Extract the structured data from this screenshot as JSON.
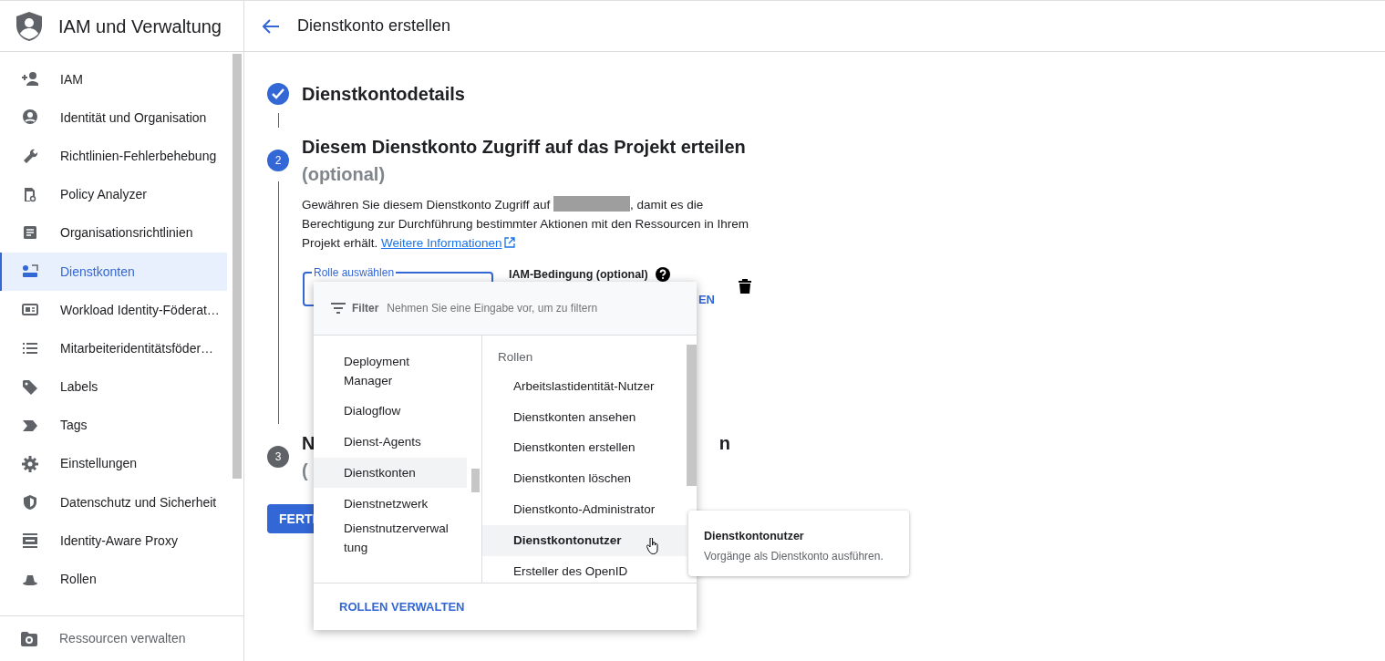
{
  "sidebar": {
    "title": "IAM und Verwaltung",
    "items": [
      {
        "label": "IAM",
        "selected": false
      },
      {
        "label": "Identität und Organisation",
        "selected": false
      },
      {
        "label": "Richtlinien-Fehlerbehebung",
        "selected": false
      },
      {
        "label": "Policy Analyzer",
        "selected": false
      },
      {
        "label": "Organisationsrichtlinien",
        "selected": false
      },
      {
        "label": "Dienstkonten",
        "selected": true
      },
      {
        "label": "Workload Identity-Föderat…",
        "selected": false
      },
      {
        "label": "Mitarbeiteridentitätsföder…",
        "selected": false
      },
      {
        "label": "Labels",
        "selected": false
      },
      {
        "label": "Tags",
        "selected": false
      },
      {
        "label": "Einstellungen",
        "selected": false
      },
      {
        "label": "Datenschutz und Sicherheit",
        "selected": false
      },
      {
        "label": "Identity-Aware Proxy",
        "selected": false
      },
      {
        "label": "Rollen",
        "selected": false
      }
    ],
    "footer": "Ressourcen verwalten"
  },
  "header": {
    "title": "Dienstkonto erstellen"
  },
  "steps": [
    {
      "kind": "done",
      "title": "Dienstkontodetails"
    },
    {
      "kind": "active",
      "number": "2",
      "title": "Diesem Dienstkonto Zugriff auf das Projekt erteilen",
      "subtitle": "(optional)",
      "description_before": "Gewähren Sie diesem Dienstkonto Zugriff auf",
      "description_after": ", damit es die Berechtigung zur Durchführung bestimmter Aktionen mit den Ressourcen in Ihrem Projekt erhält.",
      "link": "Weitere Informationen"
    },
    {
      "kind": "pending",
      "number": "3",
      "title_start": "N",
      "title_end": "n",
      "subtitle": "("
    }
  ],
  "role_field": {
    "label": "Rolle auswählen"
  },
  "condition": {
    "label": "IAM-Bedingung (optional)",
    "button": "EN"
  },
  "done_button": "FERTI",
  "menu": {
    "filter_label": "Filter",
    "filter_placeholder": "Nehmen Sie eine Eingabe vor, um zu filtern",
    "services": [
      {
        "label": "Deployment Manager",
        "selected": false
      },
      {
        "label": "Dialogflow",
        "selected": false
      },
      {
        "label": "Dienst-Agents",
        "selected": false
      },
      {
        "label": "Dienstkonten",
        "selected": true
      },
      {
        "label": "Dienstnetzwerk",
        "selected": false
      },
      {
        "label": "Dienstnutzerverwal tung",
        "selected": false
      }
    ],
    "roles_header": "Rollen",
    "roles": [
      {
        "label": "Arbeitslastidentität-Nutzer",
        "selected": false
      },
      {
        "label": "Dienstkonten ansehen",
        "selected": false
      },
      {
        "label": "Dienstkonten erstellen",
        "selected": false
      },
      {
        "label": "Dienstkonten löschen",
        "selected": false
      },
      {
        "label": "Dienstkonto-Administrator",
        "selected": false
      },
      {
        "label": "Dienstkontonutzer",
        "selected": true
      },
      {
        "label": "Ersteller des OpenID",
        "selected": false
      }
    ],
    "footer_button": "ROLLEN VERWALTEN"
  },
  "tooltip": {
    "title": "Dienstkontonutzer",
    "text": "Vorgänge als Dienstkonto ausführen."
  }
}
